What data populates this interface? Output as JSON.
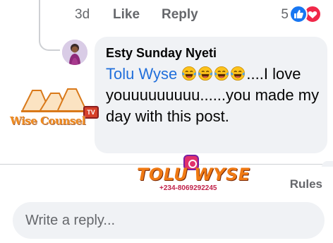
{
  "previous_comment": {
    "time": "3d",
    "like_label": "Like",
    "reply_label": "Reply",
    "reaction_count": "5",
    "reaction_icons": [
      "like-icon",
      "love-icon"
    ]
  },
  "reply": {
    "author": "Esty Sunday Nyeti",
    "mention": "Tolu Wyse",
    "emoji_name": "tears-of-joy-emoji",
    "emoji_count": 4,
    "text_after": "....I love youuuuuuuuu......you made my day with this post."
  },
  "watermark": {
    "text": "Wise Counsel",
    "badge": "TV"
  },
  "brand_overlay": {
    "name": "TOLU WYSE",
    "phone": "+234-8069292245",
    "icon": "instagram-icon"
  },
  "footer": {
    "rules_label": "Rules",
    "reply_placeholder": "Write a reply..."
  },
  "colors": {
    "accent_blue": "#216fdb",
    "like_blue": "#1877f2",
    "love_red": "#f02849",
    "bubble_bg": "#f0f2f5",
    "muted_text": "#65676b"
  }
}
